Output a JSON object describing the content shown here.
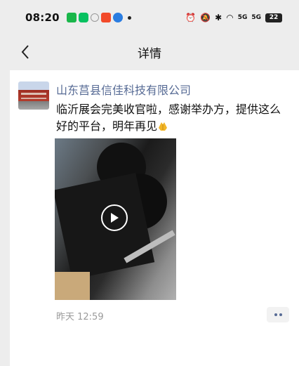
{
  "status_bar": {
    "time": "08:20",
    "signal1": "5G",
    "signal2": "5G",
    "battery": "22"
  },
  "nav": {
    "back_icon": "chevron-left-icon",
    "title": "详情"
  },
  "post": {
    "author": "山东莒县信佳科技有限公司",
    "text": "临沂展会完美收官啦，感谢举办方，提供这么好的平台，明年再见",
    "emoji": "folded-hands-icon",
    "video_icon": "play-icon",
    "timestamp": "昨天 12:59",
    "more_icon": "more-dots-icon"
  },
  "colors": {
    "author_link": "#576b95",
    "background": "#ededed",
    "card": "#ffffff"
  }
}
